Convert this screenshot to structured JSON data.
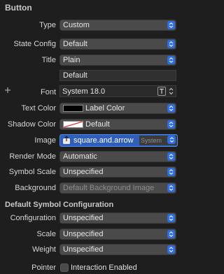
{
  "title": "Button",
  "rows": {
    "type": {
      "label": "Type",
      "value": "Custom"
    },
    "state_config": {
      "label": "State Config",
      "value": "Default"
    },
    "title": {
      "label": "Title",
      "value": "Plain"
    },
    "title_text": "Default",
    "font": {
      "label": "Font",
      "value": "System 18.0"
    },
    "text_color": {
      "label": "Text Color",
      "value": "Label Color"
    },
    "shadow_color": {
      "label": "Shadow Color",
      "value": "Default"
    },
    "image": {
      "label": "Image",
      "value": "square.and.arrow",
      "badge": "System"
    },
    "render_mode": {
      "label": "Render Mode",
      "value": "Automatic"
    },
    "symbol_scale": {
      "label": "Symbol Scale",
      "value": "Unspecified"
    },
    "background": {
      "label": "Background",
      "placeholder": "Default Background Image"
    }
  },
  "symbol_section": {
    "title": "Default Symbol Configuration",
    "configuration": {
      "label": "Configuration",
      "value": "Unspecified"
    },
    "scale": {
      "label": "Scale",
      "value": "Unspecified"
    },
    "weight": {
      "label": "Weight",
      "value": "Unspecified"
    }
  },
  "pointer": {
    "label": "Pointer",
    "checkbox_label": "Interaction Enabled"
  },
  "colors": {
    "accent": "#2f6ee0",
    "popup_bg": "#4a4a4a",
    "panel_bg": "#1e1e1e"
  }
}
